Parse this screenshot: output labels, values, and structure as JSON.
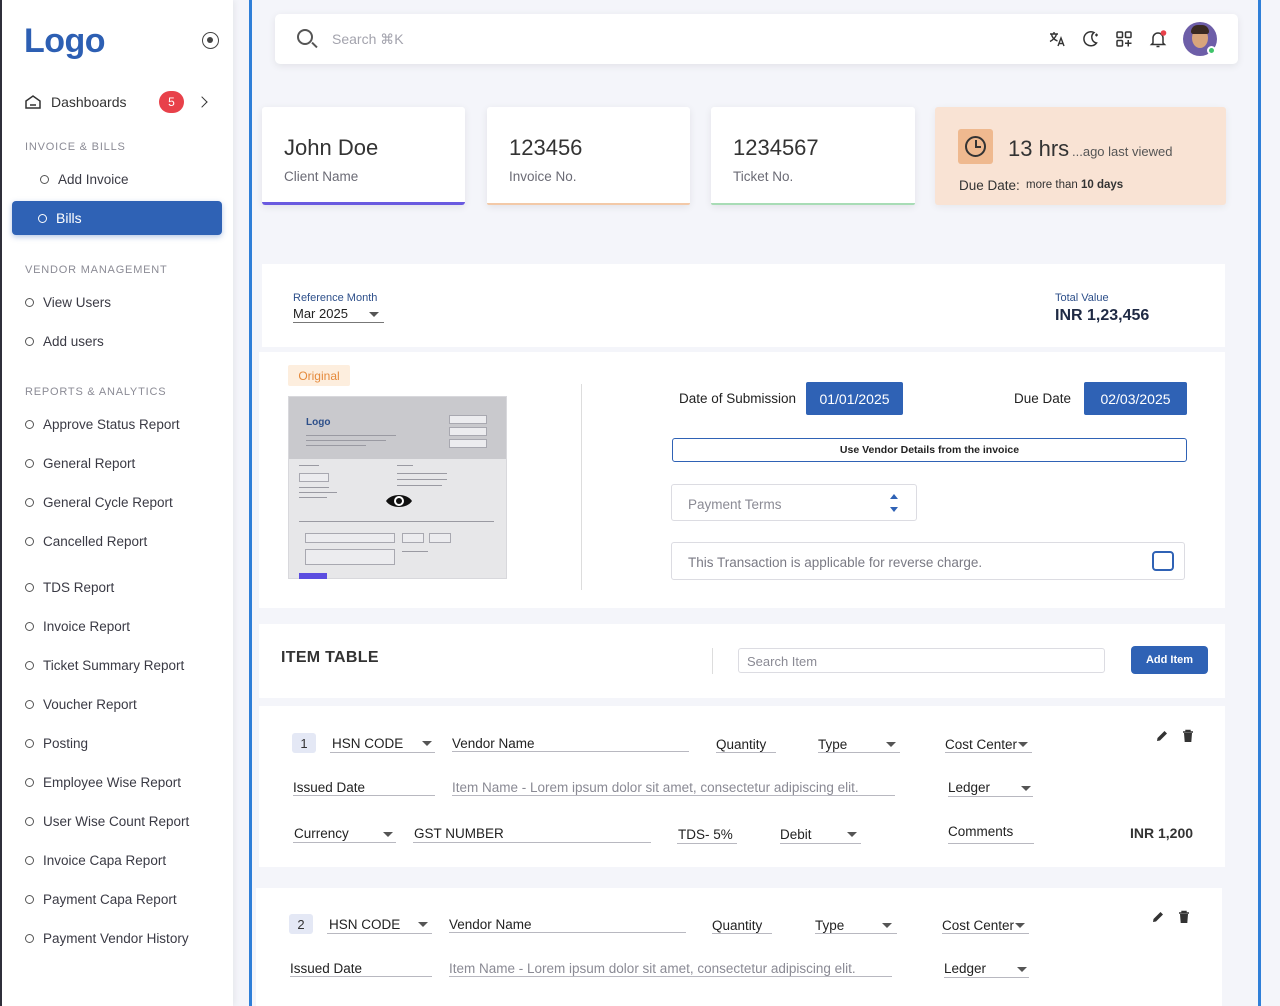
{
  "sidebar": {
    "logo": "Logo",
    "dashboards": {
      "label": "Dashboards",
      "badge": "5"
    },
    "sections": [
      {
        "title": "INVOICE & BILLS",
        "items": [
          "Add Invoice",
          "Bills"
        ]
      },
      {
        "title": "VENDOR MANAGEMENT",
        "items": [
          "View Users",
          "Add users"
        ]
      },
      {
        "title": "REPORTS & ANALYTICS",
        "items": [
          "Approve Status Report",
          "General Report",
          "General Cycle Report",
          "Cancelled Report",
          "TDS Report",
          "Invoice Report",
          "Ticket Summary Report",
          "Voucher Report",
          "Posting",
          "Employee Wise Report",
          "User Wise Count Report",
          "Invoice Capa Report",
          "Payment Capa Report",
          "Payment Vendor History"
        ]
      }
    ]
  },
  "topbar": {
    "search_placeholder": "Search ⌘K"
  },
  "cards": [
    {
      "value": "John Doe",
      "caption": "Client Name",
      "accent": "#6a5ae0"
    },
    {
      "value": "123456",
      "caption": "Invoice No.",
      "accent": "#f3c9a8"
    },
    {
      "value": "1234567",
      "caption": "Ticket No.",
      "accent": "#a8dcb6"
    }
  ],
  "last_viewed": {
    "hours": "13 hrs",
    "suffix": "...ago last viewed",
    "due_label": "Due Date:",
    "due_prefix": "more than",
    "due_days": "10 days"
  },
  "reference": {
    "label": "Reference Month",
    "value": "Mar 2025"
  },
  "total": {
    "label": "Total Value",
    "value": "INR 1,23,456"
  },
  "invoice": {
    "badge": "Original",
    "preview_logo": "Logo",
    "date_submission_label": "Date of Submission",
    "date_submission": "01/01/2025",
    "due_date_label": "Due Date",
    "due_date": "02/03/2025",
    "vendor_button": "Use Vendor Details from the invoice",
    "payment_terms_placeholder": "Payment Terms",
    "reverse_charge_text": "This Transaction is applicable for reverse charge."
  },
  "item_table": {
    "title": "ITEM TABLE",
    "search_placeholder": "Search Item",
    "add_button": "Add Item",
    "rows": [
      {
        "num": "1",
        "hsn": "HSN CODE",
        "vendor": "Vendor Name",
        "quantity": "Quantity",
        "type": "Type",
        "cost_center": "Cost Center",
        "issued_date": "Issued Date",
        "item_name": "Item Name - Lorem ipsum dolor sit amet, consectetur adipiscing elit.",
        "ledger": "Ledger",
        "currency": "Currency",
        "gst": "GST NUMBER",
        "tds": "TDS- 5%",
        "debit": "Debit",
        "comments": "Comments",
        "amount": "INR 1,200"
      },
      {
        "num": "2",
        "hsn": "HSN CODE",
        "vendor": "Vendor Name",
        "quantity": "Quantity",
        "type": "Type",
        "cost_center": "Cost Center",
        "issued_date": "Issued Date",
        "item_name": "Item Name - Lorem ipsum dolor sit amet, consectetur adipiscing elit.",
        "ledger": "Ledger"
      }
    ]
  }
}
